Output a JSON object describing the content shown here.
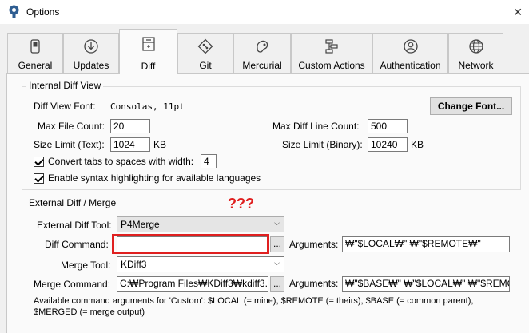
{
  "window": {
    "title": "Options",
    "close_glyph": "✕"
  },
  "tabs": [
    {
      "label": "General",
      "icon": "toggle-icon"
    },
    {
      "label": "Updates",
      "icon": "download-icon"
    },
    {
      "label": "Diff",
      "icon": "diff-icon",
      "selected": true
    },
    {
      "label": "Git",
      "icon": "git-icon"
    },
    {
      "label": "Mercurial",
      "icon": "mercurial-icon"
    },
    {
      "label": "Custom Actions",
      "icon": "flow-icon"
    },
    {
      "label": "Authentication",
      "icon": "user-icon"
    },
    {
      "label": "Network",
      "icon": "globe-icon"
    }
  ],
  "internal": {
    "title": "Internal Diff View",
    "font_label": "Diff View Font:",
    "font_value": "Consolas, 11pt",
    "change_font": "Change Font...",
    "max_file_count_label": "Max File Count:",
    "max_file_count": "20",
    "max_diff_line_label": "Max Diff Line Count:",
    "max_diff_line": "500",
    "size_text_label": "Size Limit (Text):",
    "size_text": "1024",
    "size_text_unit": "KB",
    "size_binary_label": "Size Limit (Binary):",
    "size_binary": "10240",
    "size_binary_unit": "KB",
    "convert_tabs_label": "Convert tabs to spaces with width:",
    "convert_tabs_checked": true,
    "tab_width": "4",
    "syntax_label": "Enable syntax highlighting for available languages",
    "syntax_checked": true
  },
  "external": {
    "title": "External Diff / Merge",
    "annotation": "???",
    "diff_tool_label": "External Diff Tool:",
    "diff_tool": "P4Merge",
    "diff_cmd_label": "Diff Command:",
    "diff_cmd": "",
    "browse": "...",
    "args_label": "Arguments:",
    "diff_args": "₩\"$LOCAL₩\" ₩\"$REMOTE₩\"",
    "merge_tool_label": "Merge Tool:",
    "merge_tool": "KDiff3",
    "merge_cmd_label": "Merge Command:",
    "merge_cmd": "C:₩Program Files₩KDiff3₩kdiff3.e",
    "merge_args": "₩\"$BASE₩\" ₩\"$LOCAL₩\" ₩\"$REMOTE",
    "help_line1": "Available command arguments for 'Custom': $LOCAL (= mine), $REMOTE (= theirs), $BASE (= common parent),",
    "help_line2": "$MERGED (= merge output)"
  },
  "colors": {
    "highlight": "#e02020"
  }
}
